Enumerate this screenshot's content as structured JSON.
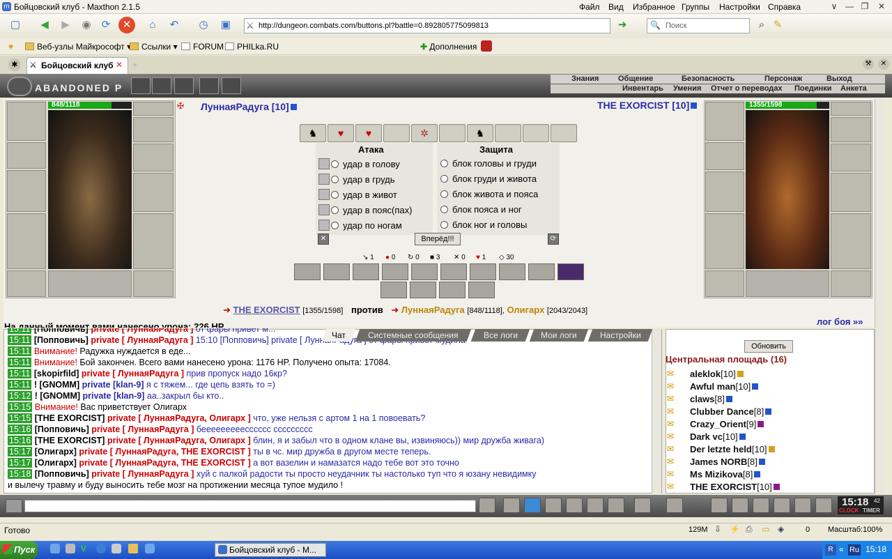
{
  "window": {
    "title": "Бойцовский клуб - Maxthon 2.1.5"
  },
  "menu": [
    "Файл",
    "Вид",
    "Избранное",
    "Группы",
    "Настройки",
    "Справка"
  ],
  "address": {
    "url": "http://dungeon.combats.com/buttons.pl?battle=0.892805775099813"
  },
  "search": {
    "placeholder": "Поиск"
  },
  "favorites": [
    "Веб-узлы Майкрософт",
    "Ссылки",
    "FORUM",
    "PHILka.RU"
  ],
  "addons": "Дополнения",
  "tab": {
    "label": "Бойцовский клуб"
  },
  "game": {
    "logo": "ABANDONED P",
    "nav_top": [
      "Знания",
      "Общение",
      "Безопасность",
      "Персонаж",
      "Выход"
    ],
    "nav_bottom": [
      "Инвентарь",
      "Умения",
      "Отчет о переводах",
      "Поединки",
      "Анкета"
    ],
    "left_hp": "848/1118",
    "left_hp_pct": 0.76,
    "left_name": "ЛуннаяРадуга [10]",
    "right_hp": "1355/1598",
    "right_hp_pct": 0.85,
    "right_name": "THE EXORCIST [10]",
    "attack_title": "Атака",
    "defense_title": "Защита",
    "attacks": [
      "удар в голову",
      "удар в грудь",
      "удар в живот",
      "удар в пояс(пах)",
      "удар по ногам"
    ],
    "defenses": [
      "блок головы и груди",
      "блок груди и живота",
      "блок живота и пояса",
      "блок пояса и ног",
      "блок ног и головы"
    ],
    "go_button": "Вперёд!!!",
    "stats": [
      "1",
      "0",
      "0",
      "3",
      "0",
      "1",
      "30"
    ],
    "versus": {
      "enemy": "THE EXORCIST",
      "enemy_hp": "[1355/1598]",
      "vs": "против",
      "ally1": "ЛуннаяРадуга",
      "ally1_hp": "[848/1118],",
      "ally2": "Олигарх",
      "ally2_hp": "[2043/2043]"
    },
    "log_link": "лог боя »»",
    "partial_line": "На данный момент вами нанесено урона: 226 HP."
  },
  "chat": {
    "tabs": [
      "Чат",
      "Системные сообщения",
      "Все логи",
      "Мои логи",
      "Настройки"
    ],
    "lines": [
      {
        "t": "15:11",
        "who": "[Попповичь]",
        "priv": "private [ ЛуннаяРадуга ]",
        "msg": "от фары привет м..."
      },
      {
        "t": "15:11",
        "who": "[Попповичь]",
        "priv": "private [ ЛуннаяРадуга ]",
        "msg": "15:10 [Попповичь] private [ ЛуннаяРадуга ] от фары привет мудила"
      },
      {
        "t": "15:11",
        "who": "",
        "priv": "Внимание!",
        "msg": "Радужка нуждается в еде..."
      },
      {
        "t": "15:11",
        "who": "",
        "priv": "Внимание!",
        "msg": "Бой закончен. Всего вами нанесено урона: 1176 HP. Получено опыта: 17084."
      },
      {
        "t": "15:11",
        "who": "[skopirfild]",
        "priv": "private [ ЛуннаяРадуга ]",
        "msg": "прив пропуск надо 16кр?"
      },
      {
        "t": "15:11",
        "who": "! [GNOMM]",
        "priv": "private [klan-9]",
        "msg": "я с тяжем... где цепь взять то =)"
      },
      {
        "t": "15:12",
        "who": "! [GNOMM]",
        "priv": "private [klan-9]",
        "msg": "аа..закрыл бы кто.."
      },
      {
        "t": "15:15",
        "who": "",
        "priv": "Внимание!",
        "msg": "Вас приветствует Олигарх"
      },
      {
        "t": "15:15",
        "who": "[THE EXORCIST]",
        "priv": "private [ ЛуннаяРадуга, Олигарх ]",
        "msg": "что, уже нельзя с артом 1 на 1 повоевать?"
      },
      {
        "t": "15:16",
        "who": "[Попповичь]",
        "priv": "private [ ЛуннаяРадуга ]",
        "msg": "бееееееееесссссс ссссссссс"
      },
      {
        "t": "15:16",
        "who": "[THE EXORCIST]",
        "priv": "private [ ЛуннаяРадуга, Олигарх ]",
        "msg": "блин, я и забыл что в одном клане вы, извиняюсь)) мир дружба живага)"
      },
      {
        "t": "15:17",
        "who": "[Олигарх]",
        "priv": "private [ ЛуннаяРадуга, THE EXORCIST ]",
        "msg": "ты в чс. мир дружба в другом месте теперь."
      },
      {
        "t": "15:17",
        "who": "[Олигарх]",
        "priv": "private [ ЛуннаяРадуга, THE EXORCIST ]",
        "msg": "а вот вазелин и намазатся надо тебе вот это точно"
      },
      {
        "t": "15:18",
        "who": "[Попповичь]",
        "priv": "private [ ЛуннаяРадуга ]",
        "msg": "хуй с палкой радости ты просто неудачник ты настолько туп что я юзану невидимку"
      },
      {
        "t": "",
        "who": "",
        "priv": "",
        "msg": "и вылечу травму и буду выносить тебе мозг на протижении месяца тупое мудило !"
      }
    ]
  },
  "room": {
    "refresh": "Обновить",
    "title": "Центральная площадь (16)",
    "users": [
      {
        "name": "aleklok",
        "lvl": "[10]",
        "badge": "y"
      },
      {
        "name": "Awful man",
        "lvl": "[10]",
        "badge": "b"
      },
      {
        "name": "claws",
        "lvl": "[8]",
        "badge": "b"
      },
      {
        "name": "Clubber Dance",
        "lvl": "[8]",
        "badge": "b"
      },
      {
        "name": "Crazy_Orient",
        "lvl": "[9]",
        "badge": "v"
      },
      {
        "name": "Dark vc",
        "lvl": "[10]",
        "badge": "b"
      },
      {
        "name": "Der letzte held",
        "lvl": "[10]",
        "badge": "y"
      },
      {
        "name": "James NORB",
        "lvl": "[8]",
        "badge": "b"
      },
      {
        "name": "Ms Mizikova",
        "lvl": "[8]",
        "badge": "b"
      },
      {
        "name": "THE EXORCIST",
        "lvl": "[10]",
        "badge": "v"
      }
    ]
  },
  "clock": "15:18",
  "clock_sec": "42",
  "clock_labels": [
    "CLOCK",
    "TIMER"
  ],
  "status": {
    "text": "Готово",
    "mem": "129M",
    "zero": "0",
    "zoom": "Масштаб:100%"
  },
  "taskbar": {
    "start": "Пуск",
    "item": "Бойцовский клуб - M...",
    "lang": "Ru",
    "time": "15:18"
  }
}
